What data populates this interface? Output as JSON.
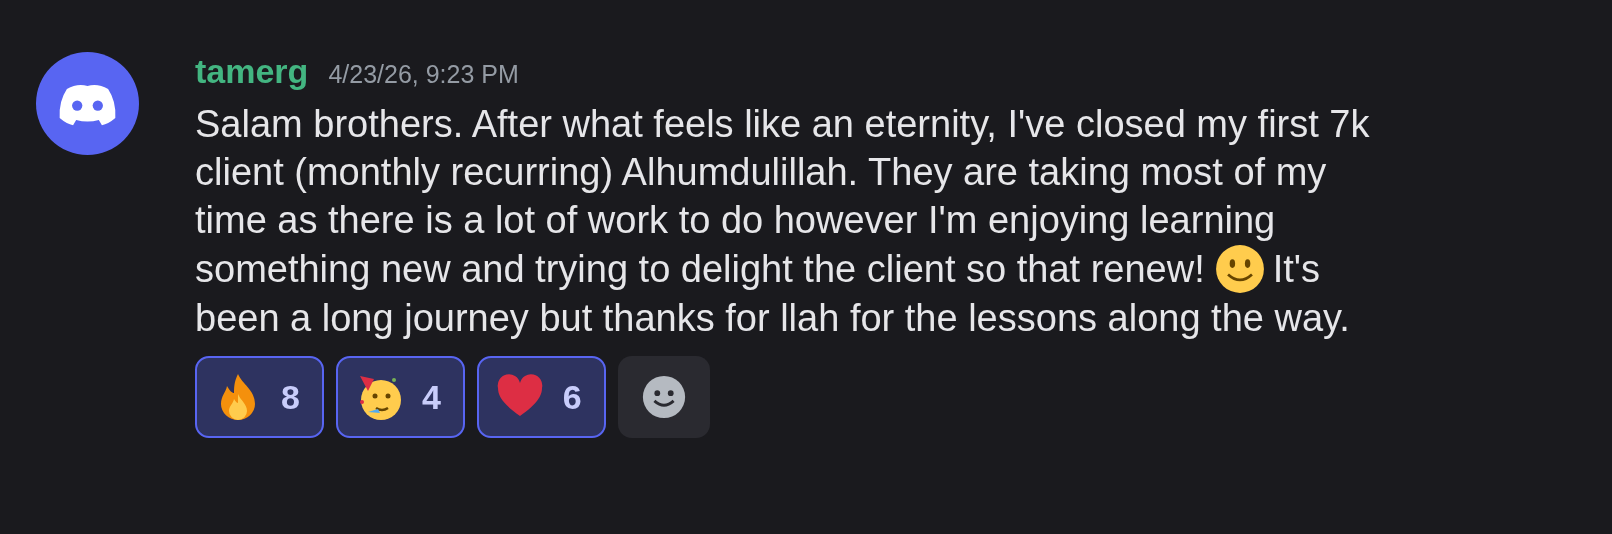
{
  "message": {
    "author": "tamerg",
    "timestamp": "4/23/26, 9:23 PM",
    "lines": [
      [
        {
          "kind": "text",
          "text": "Salam brothers. After what feels like an eternity, I've closed my first 7k"
        }
      ],
      [
        {
          "kind": "text",
          "text": "client (monthly recurring) Alhumdulillah. They are taking most of my"
        }
      ],
      [
        {
          "kind": "text",
          "text": "time as there is a lot of work to do however I'm enjoying learning"
        }
      ],
      [
        {
          "kind": "text",
          "text": "something new and trying to delight the client so that renew!"
        },
        {
          "kind": "emoji"
        },
        {
          "kind": "text",
          "text": "It's"
        }
      ],
      [
        {
          "kind": "text",
          "text": "been a long journey but thanks for llah for the lessons along the way."
        }
      ]
    ],
    "reactions": [
      {
        "kind": "fire",
        "count": "8",
        "selected": true
      },
      {
        "kind": "party",
        "count": "4",
        "selected": true
      },
      {
        "kind": "heart",
        "count": "6",
        "selected": true
      }
    ]
  }
}
